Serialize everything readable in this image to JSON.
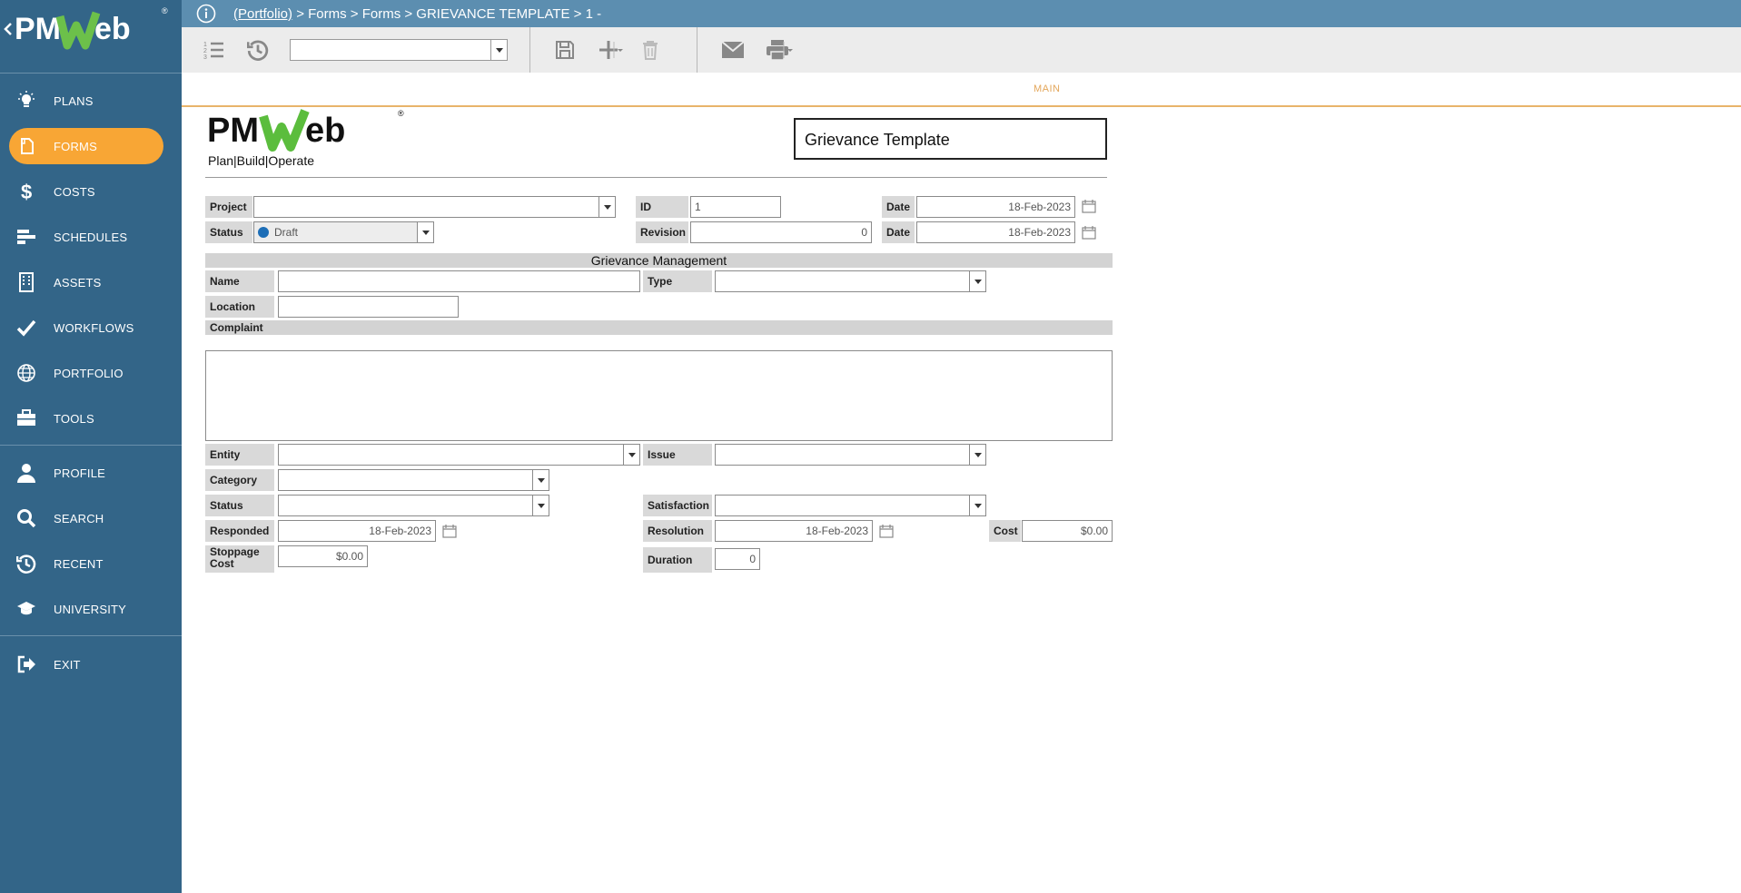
{
  "sidebar": {
    "items": [
      {
        "label": "PLANS",
        "icon": "lightbulb-icon"
      },
      {
        "label": "FORMS",
        "icon": "document-icon",
        "active": true
      },
      {
        "label": "COSTS",
        "icon": "dollar-icon"
      },
      {
        "label": "SCHEDULES",
        "icon": "gantt-icon"
      },
      {
        "label": "ASSETS",
        "icon": "building-icon"
      },
      {
        "label": "WORKFLOWS",
        "icon": "checkmark-icon"
      },
      {
        "label": "PORTFOLIO",
        "icon": "globe-icon"
      },
      {
        "label": "TOOLS",
        "icon": "toolbox-icon"
      },
      {
        "label": "PROFILE",
        "icon": "user-icon"
      },
      {
        "label": "SEARCH",
        "icon": "search-icon"
      },
      {
        "label": "RECENT",
        "icon": "history-icon"
      },
      {
        "label": "UNIVERSITY",
        "icon": "graduation-cap-icon"
      },
      {
        "label": "EXIT",
        "icon": "exit-icon"
      }
    ]
  },
  "breadcrumb": {
    "link": "(Portfolio)",
    "rest": " > Forms > Forms > GRIEVANCE TEMPLATE > 1 -"
  },
  "toolbar": {
    "record_select_value": ""
  },
  "tabs": {
    "main": "MAIN"
  },
  "form": {
    "logo_tagline": "Plan|Build|Operate",
    "template_title": "Grievance Template",
    "project_label": "Project",
    "project_value": "",
    "status_label": "Status",
    "status_value": "Draft",
    "id_label": "ID",
    "id_value": "1",
    "revision_label": "Revision",
    "revision_value": "0",
    "date_label": "Date",
    "date1_value": "18-Feb-2023",
    "date2_value": "18-Feb-2023",
    "section_title": "Grievance Management",
    "name_label": "Name",
    "type_label": "Type",
    "location_label": "Location",
    "complaint_label": "Complaint",
    "entity_label": "Entity",
    "issue_label": "Issue",
    "category_label": "Category",
    "status2_label": "Status",
    "satisfaction_label": "Satisfaction",
    "responded_label": "Responded",
    "responded_value": "18-Feb-2023",
    "resolution_label": "Resolution",
    "resolution_value": "18-Feb-2023",
    "cost_label": "Cost",
    "cost_value": "$0.00",
    "stoppage_label_1": "Stoppage",
    "stoppage_label_2": "Cost",
    "stoppage_value": "$0.00",
    "duration_label": "Duration",
    "duration_value": "0"
  },
  "colors": {
    "sidebar_bg": "#336588",
    "active_item": "#f8a635",
    "topbar_bg": "#5c8eb0",
    "tab_accent": "#e3a65a",
    "status_dot": "#1d6eb7"
  }
}
